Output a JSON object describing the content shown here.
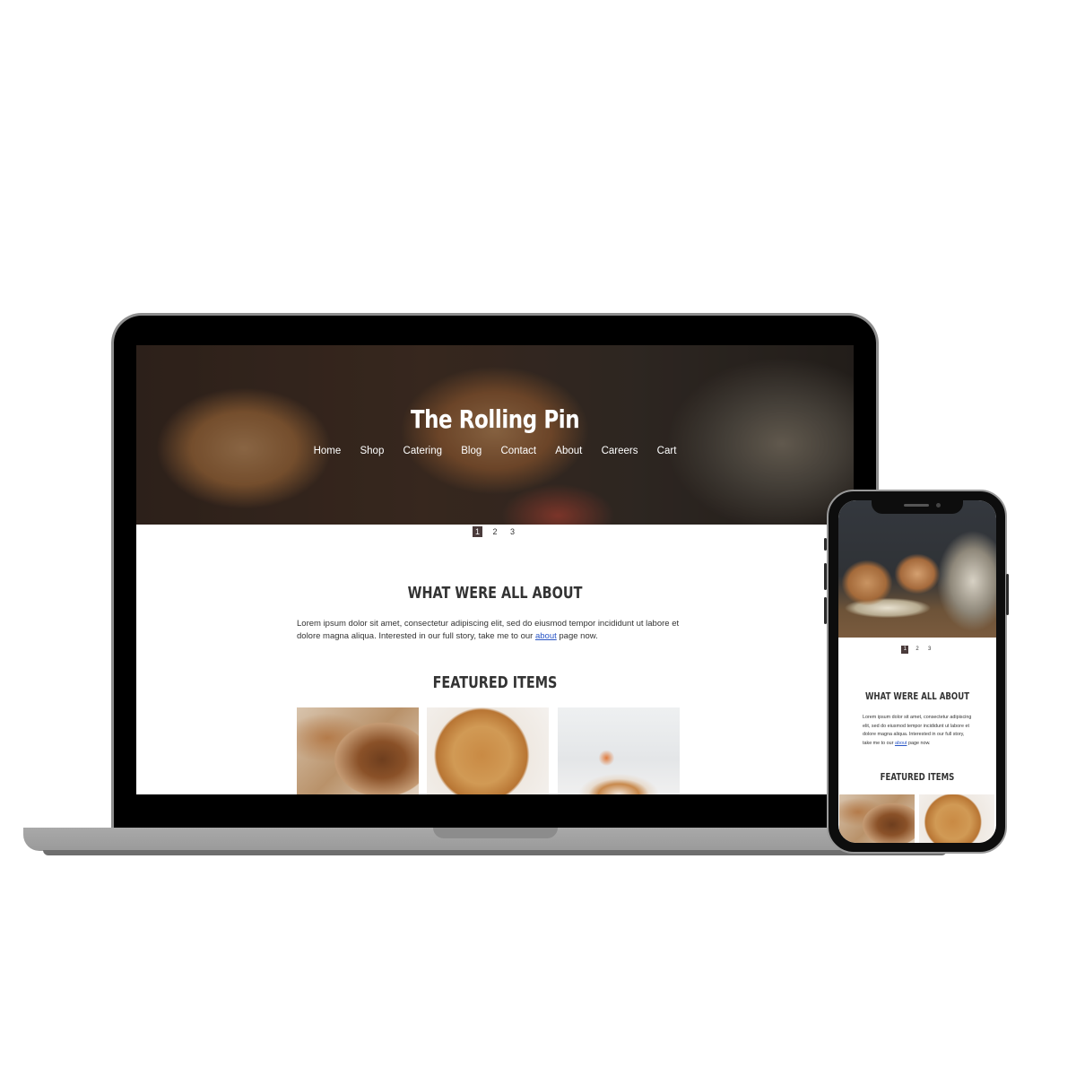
{
  "site": {
    "title": "The Rolling Pin",
    "nav": [
      "Home",
      "Shop",
      "Catering",
      "Blog",
      "Contact",
      "About",
      "Careers",
      "Cart"
    ]
  },
  "slider": {
    "pages": [
      "1",
      "2",
      "3"
    ],
    "active": 0
  },
  "about": {
    "heading": "WHAT WERE ALL ABOUT",
    "text_before": "Lorem ipsum dolor sit amet, consectetur adipiscing elit, sed do eiusmod tempor incididunt ut labore et dolore magna aliqua. Interested in our full story, take me to our ",
    "link": "about",
    "text_after": " page now."
  },
  "featured": {
    "heading": "FEATURED ITEMS",
    "items": [
      "bread",
      "pie",
      "tart"
    ]
  },
  "colors": {
    "pager_active": "#4a3b3b",
    "link": "#2a56c6",
    "heading": "#333333"
  }
}
